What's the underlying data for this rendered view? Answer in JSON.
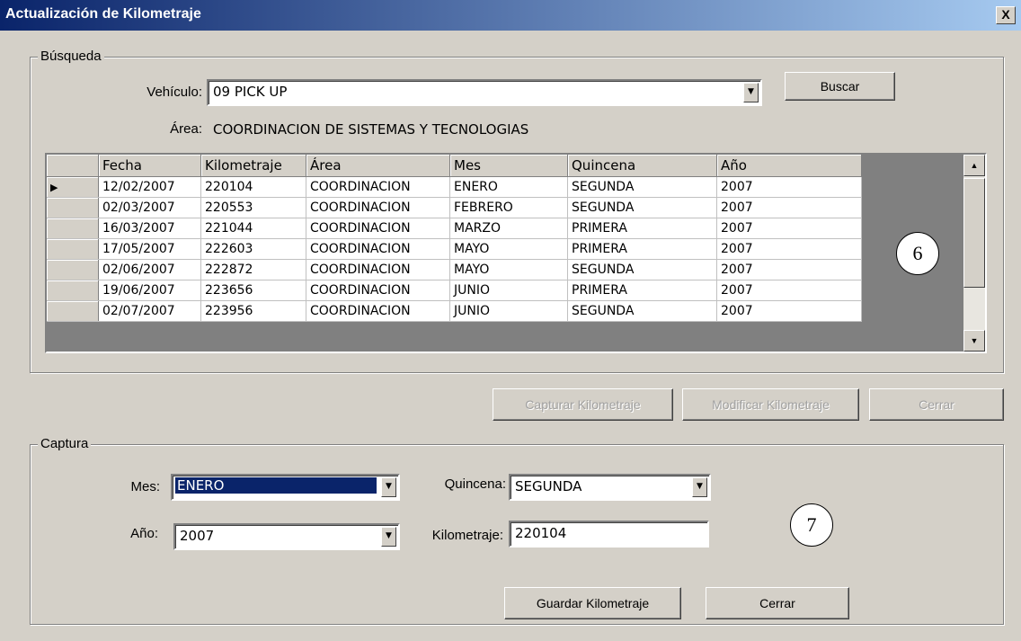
{
  "window": {
    "title": "Actualización de Kilometraje",
    "close_label": "X"
  },
  "busqueda": {
    "legend": "Búsqueda",
    "vehiculo_label": "Vehículo:",
    "vehiculo_value": "09  PICK UP",
    "buscar_label": "Buscar",
    "area_label": "Área:",
    "area_value": "COORDINACION DE SISTEMAS Y TECNOLOGIAS"
  },
  "grid": {
    "columns": [
      "Fecha",
      "Kilometraje",
      "Área",
      "Mes",
      "Quincena",
      "Año"
    ],
    "current_row_indicator": "▶",
    "rows": [
      [
        "12/02/2007",
        "220104",
        "COORDINACION",
        "ENERO",
        "SEGUNDA",
        "2007"
      ],
      [
        "02/03/2007",
        "220553",
        "COORDINACION",
        "FEBRERO",
        "SEGUNDA",
        "2007"
      ],
      [
        "16/03/2007",
        "221044",
        "COORDINACION",
        "MARZO",
        "PRIMERA",
        "2007"
      ],
      [
        "17/05/2007",
        "222603",
        "COORDINACION",
        "MAYO",
        "PRIMERA",
        "2007"
      ],
      [
        "02/06/2007",
        "222872",
        "COORDINACION",
        "MAYO",
        "SEGUNDA",
        "2007"
      ],
      [
        "19/06/2007",
        "223656",
        "COORDINACION",
        "JUNIO",
        "PRIMERA",
        "2007"
      ],
      [
        "02/07/2007",
        "223956",
        "COORDINACION",
        "JUNIO",
        "SEGUNDA",
        "2007"
      ]
    ]
  },
  "actions": {
    "capturar_label": "Capturar Kilometraje",
    "modificar_label": "Modificar Kilometraje",
    "cerrar_label": "Cerrar"
  },
  "captura": {
    "legend": "Captura",
    "mes_label": "Mes:",
    "mes_value": "ENERO",
    "quincena_label": "Quincena:",
    "quincena_value": "SEGUNDA",
    "anio_label": "Año:",
    "anio_value": "2007",
    "kilometraje_label": "Kilometraje:",
    "kilometraje_value": "220104",
    "guardar_label": "Guardar Kilometraje",
    "cerrar_label": "Cerrar"
  },
  "callouts": {
    "grid": "6",
    "captura": "7"
  },
  "icons": {
    "dropdown": "triangle-down",
    "scroll_up": "triangle-up",
    "scroll_down": "triangle-down"
  },
  "colors": {
    "title_bar": "#0a246a",
    "selection": "#0a246a",
    "grid_background": "#808080",
    "window": "#d4d0c8"
  }
}
